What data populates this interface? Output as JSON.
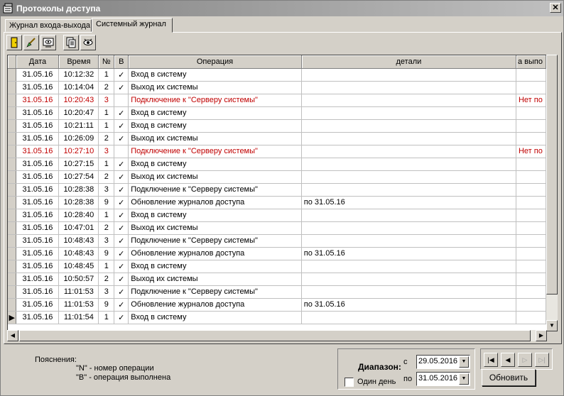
{
  "window": {
    "title": "Протоколы доступа",
    "close_label": "✕"
  },
  "tabs": [
    {
      "label": "Журнал входа-выхода"
    },
    {
      "label": "Системный журнал"
    }
  ],
  "toolbar": {
    "icons": [
      "door-exit-icon",
      "brush-icon",
      "screen-view-icon",
      "print-report-icon",
      "eye-view-icon"
    ]
  },
  "grid": {
    "columns": [
      "Дата",
      "Время",
      "№",
      "В",
      "Операция",
      "детали",
      "а выпо"
    ],
    "rows": [
      {
        "date": "31.05.16",
        "time": "10:12:32",
        "n": "1",
        "b": "✓",
        "op": "Вход в систему",
        "details": "",
        "extra": "",
        "error": false
      },
      {
        "date": "31.05.16",
        "time": "10:14:04",
        "n": "2",
        "b": "✓",
        "op": "Выход их системы",
        "details": "",
        "extra": "",
        "error": false
      },
      {
        "date": "31.05.16",
        "time": "10:20:43",
        "n": "3",
        "b": "",
        "op": "Подключение к \"Серверу системы\"",
        "details": "",
        "extra": "Нет по",
        "error": true
      },
      {
        "date": "31.05.16",
        "time": "10:20:47",
        "n": "1",
        "b": "✓",
        "op": "Вход в систему",
        "details": "",
        "extra": "",
        "error": false
      },
      {
        "date": "31.05.16",
        "time": "10:21:11",
        "n": "1",
        "b": "✓",
        "op": "Вход в систему",
        "details": "",
        "extra": "",
        "error": false
      },
      {
        "date": "31.05.16",
        "time": "10:26:09",
        "n": "2",
        "b": "✓",
        "op": "Выход их системы",
        "details": "",
        "extra": "",
        "error": false
      },
      {
        "date": "31.05.16",
        "time": "10:27:10",
        "n": "3",
        "b": "",
        "op": "Подключение к \"Серверу системы\"",
        "details": "",
        "extra": "Нет по",
        "error": true
      },
      {
        "date": "31.05.16",
        "time": "10:27:15",
        "n": "1",
        "b": "✓",
        "op": "Вход в систему",
        "details": "",
        "extra": "",
        "error": false
      },
      {
        "date": "31.05.16",
        "time": "10:27:54",
        "n": "2",
        "b": "✓",
        "op": "Выход их системы",
        "details": "",
        "extra": "",
        "error": false
      },
      {
        "date": "31.05.16",
        "time": "10:28:38",
        "n": "3",
        "b": "✓",
        "op": "Подключение к \"Серверу системы\"",
        "details": "",
        "extra": "",
        "error": false
      },
      {
        "date": "31.05.16",
        "time": "10:28:38",
        "n": "9",
        "b": "✓",
        "op": "Обновление журналов доступа",
        "details": "по 31.05.16",
        "extra": "",
        "error": false
      },
      {
        "date": "31.05.16",
        "time": "10:28:40",
        "n": "1",
        "b": "✓",
        "op": "Вход в систему",
        "details": "",
        "extra": "",
        "error": false
      },
      {
        "date": "31.05.16",
        "time": "10:47:01",
        "n": "2",
        "b": "✓",
        "op": "Выход их системы",
        "details": "",
        "extra": "",
        "error": false
      },
      {
        "date": "31.05.16",
        "time": "10:48:43",
        "n": "3",
        "b": "✓",
        "op": "Подключение к \"Серверу системы\"",
        "details": "",
        "extra": "",
        "error": false
      },
      {
        "date": "31.05.16",
        "time": "10:48:43",
        "n": "9",
        "b": "✓",
        "op": "Обновление журналов доступа",
        "details": "по 31.05.16",
        "extra": "",
        "error": false
      },
      {
        "date": "31.05.16",
        "time": "10:48:45",
        "n": "1",
        "b": "✓",
        "op": "Вход в систему",
        "details": "",
        "extra": "",
        "error": false
      },
      {
        "date": "31.05.16",
        "time": "10:50:57",
        "n": "2",
        "b": "✓",
        "op": "Выход их системы",
        "details": "",
        "extra": "",
        "error": false
      },
      {
        "date": "31.05.16",
        "time": "11:01:53",
        "n": "3",
        "b": "✓",
        "op": "Подключение к \"Серверу системы\"",
        "details": "",
        "extra": "",
        "error": false
      },
      {
        "date": "31.05.16",
        "time": "11:01:53",
        "n": "9",
        "b": "✓",
        "op": "Обновление журналов доступа",
        "details": "по 31.05.16",
        "extra": "",
        "error": false
      },
      {
        "date": "31.05.16",
        "time": "11:01:54",
        "n": "1",
        "b": "✓",
        "op": "Вход в систему",
        "details": "",
        "extra": "",
        "error": false
      }
    ],
    "current_row_marker": "▶",
    "current_row_index": 19,
    "error_color": "#c00000"
  },
  "legend": {
    "title": "Пояснения:",
    "line1": "\"N\"  - номер операции",
    "line2": "\"B\"  - операция выполнена"
  },
  "range": {
    "label": "Диапазон:",
    "from_label": "с",
    "to_label": "по",
    "from_value": "29.05.2016",
    "to_value": "31.05.2016",
    "one_day_label": "Один день",
    "one_day_checked": false
  },
  "nav": {
    "first": "|◀",
    "prev": "◀",
    "next": "▷",
    "last": "▷|"
  },
  "refresh_label": "Обновить"
}
